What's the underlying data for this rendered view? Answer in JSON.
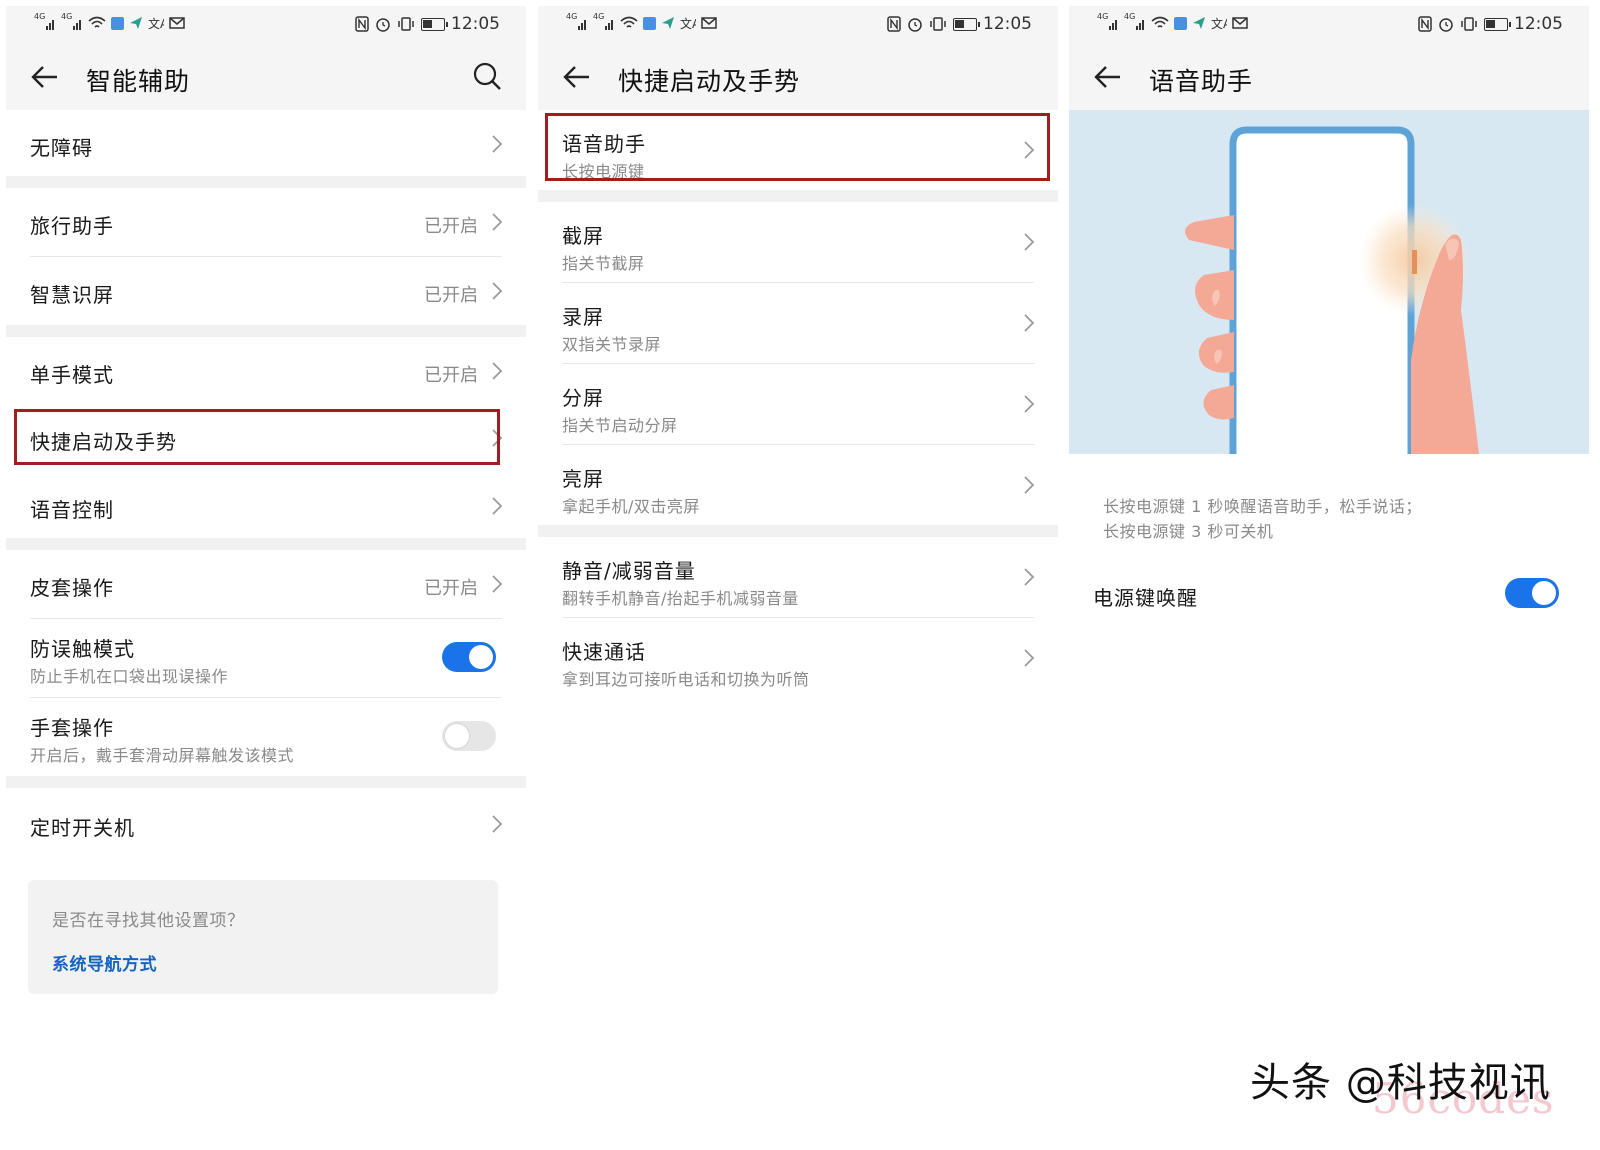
{
  "status_bar": {
    "network_left": "4G",
    "network_right": "4G",
    "time": "12:05"
  },
  "screen1": {
    "title": "智能辅助",
    "items": [
      {
        "label": "无障碍"
      },
      {
        "label": "旅行助手",
        "value": "已开启"
      },
      {
        "label": "智慧识屏",
        "value": "已开启"
      },
      {
        "label": "单手模式",
        "value": "已开启"
      },
      {
        "label": "快捷启动及手势",
        "highlighted": true
      },
      {
        "label": "语音控制"
      },
      {
        "label": "皮套操作",
        "value": "已开启"
      },
      {
        "label": "防误触模式",
        "sub": "防止手机在口袋出现误操作",
        "toggle": "on"
      },
      {
        "label": "手套操作",
        "sub": "开启后，戴手套滑动屏幕触发该模式",
        "toggle": "off"
      },
      {
        "label": "定时开关机"
      }
    ],
    "hint": {
      "question": "是否在寻找其他设置项？",
      "link": "系统导航方式"
    }
  },
  "screen2": {
    "title": "快捷启动及手势",
    "items": [
      {
        "label": "语音助手",
        "sub": "长按电源键",
        "highlighted": true
      },
      {
        "label": "截屏",
        "sub": "指关节截屏"
      },
      {
        "label": "录屏",
        "sub": "双指关节录屏"
      },
      {
        "label": "分屏",
        "sub": "指关节启动分屏"
      },
      {
        "label": "亮屏",
        "sub": "拿起手机/双击亮屏"
      },
      {
        "label": "静音/减弱音量",
        "sub": "翻转手机静音/抬起手机减弱音量"
      },
      {
        "label": "快速通话",
        "sub": "拿到耳边可接听电话和切换为听筒"
      }
    ]
  },
  "screen3": {
    "title": "语音助手",
    "description": [
      "长按电源键 1 秒唤醒语音助手，松手说话；",
      "长按电源键 3 秒可关机"
    ],
    "toggle_item": {
      "label": "电源键唤醒",
      "toggle": "on"
    }
  },
  "watermark": {
    "text": "头条 @科技视讯",
    "subtext": "56codes"
  },
  "colors": {
    "accent_blue": "#1a73e8",
    "highlight_red": "#a01e1e",
    "link_blue": "#1465c0",
    "illustration_bg": "#d8e8f2",
    "phone_frame": "#5ea3d8",
    "hand": "#f4a896"
  }
}
